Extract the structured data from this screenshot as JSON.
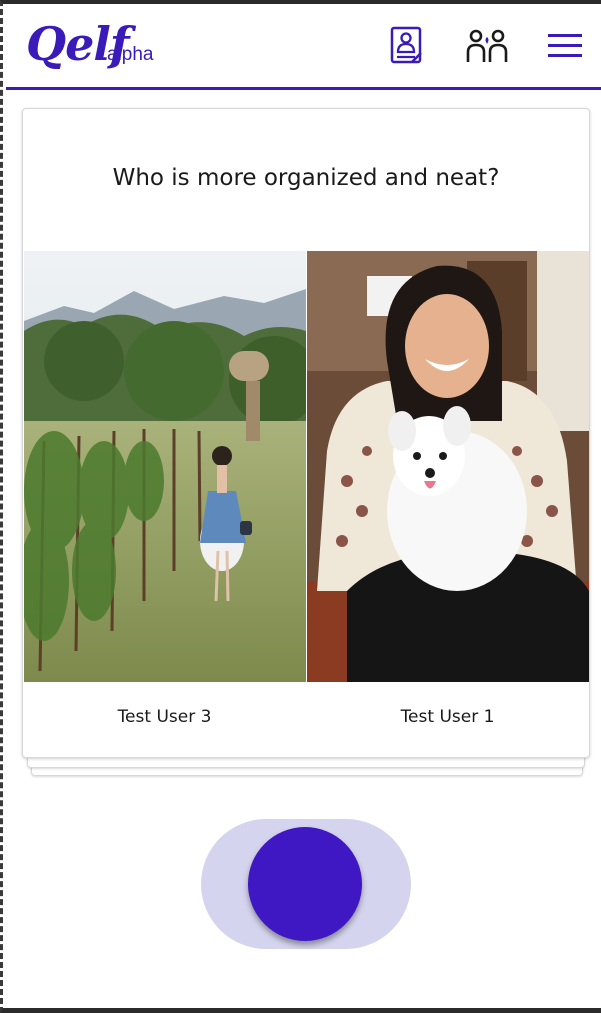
{
  "header": {
    "logo": "Qelf",
    "logo_sub": "alpha",
    "icons": [
      "profile-card-icon",
      "friends-icon",
      "hamburger-menu-icon"
    ]
  },
  "question": {
    "text": "Who is more organized and neat?"
  },
  "candidates": [
    {
      "name": "Test User 3",
      "photo": "woman in blue dress in vineyard"
    },
    {
      "name": "Test User 1",
      "photo": "smiling woman holding white puppy"
    }
  ],
  "toggle": {
    "state": "on"
  },
  "colors": {
    "brand": "#3a1ab8",
    "knob": "#3f18c4",
    "track": "#d4d4ee"
  }
}
